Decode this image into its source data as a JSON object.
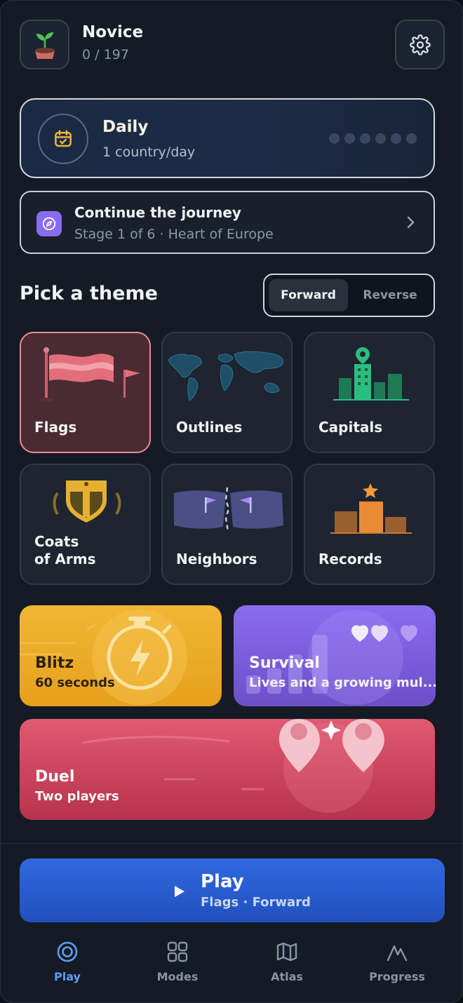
{
  "header": {
    "rank_title": "Novice",
    "rank_progress": "0 / 197",
    "avatar_icon": "sprout-icon",
    "settings_icon": "gear-icon"
  },
  "daily": {
    "title": "Daily",
    "subtitle": "1 country/day",
    "icon": "calendar-check-icon",
    "streak_total": 6,
    "streak_done": 0
  },
  "journey": {
    "title": "Continue the journey",
    "subtitle": "Stage 1 of 6 · Heart of Europe",
    "icon": "compass-icon"
  },
  "themes_section": {
    "title": "Pick a theme",
    "direction_options": [
      "Forward",
      "Reverse"
    ],
    "selected_direction": "Forward"
  },
  "themes": [
    {
      "label": "Flags",
      "selected": true
    },
    {
      "label": "Outlines",
      "selected": false
    },
    {
      "label": "Capitals",
      "selected": false
    },
    {
      "label": "Coats\nof Arms",
      "selected": false
    },
    {
      "label": "Neighbors",
      "selected": false
    },
    {
      "label": "Records",
      "selected": false
    }
  ],
  "modes": {
    "blitz": {
      "title": "Blitz",
      "subtitle": "60 seconds",
      "color": "#f1b634"
    },
    "survival": {
      "title": "Survival",
      "subtitle": "Lives and a growing mul...",
      "color": "#8a6cf0"
    },
    "duel": {
      "title": "Duel",
      "subtitle": "Two players",
      "color": "#e05a72"
    }
  },
  "play": {
    "label": "Play",
    "subtitle": "Flags · Forward",
    "color": "#2a5cd6"
  },
  "nav": [
    {
      "label": "Play",
      "icon": "target-icon",
      "active": true
    },
    {
      "label": "Modes",
      "icon": "grid-icon",
      "active": false
    },
    {
      "label": "Atlas",
      "icon": "map-icon",
      "active": false
    },
    {
      "label": "Progress",
      "icon": "mountain-chart-icon",
      "active": false
    }
  ],
  "colors": {
    "accent": "#5d9df6",
    "background": "#151b25",
    "flags_tile": "#4a2b33"
  }
}
